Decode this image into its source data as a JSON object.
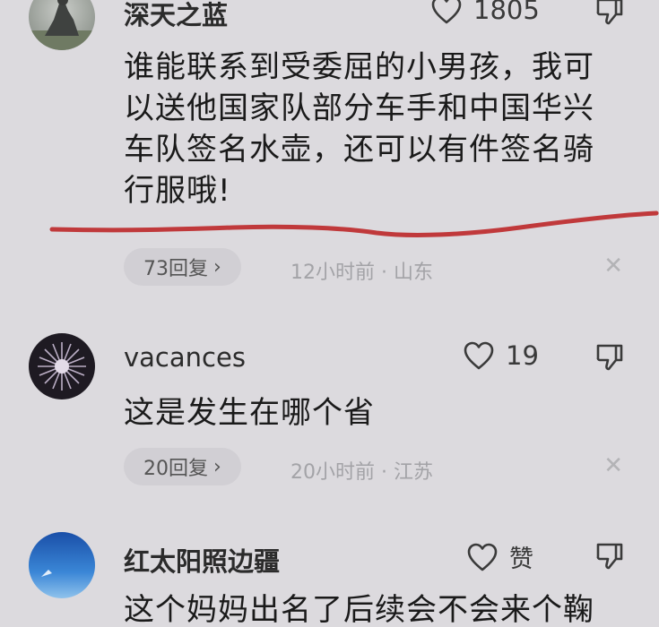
{
  "comments": [
    {
      "username": "深天之蓝",
      "likes": "1805",
      "body_lines": [
        "谁能联系到受委屈的小男孩，我可",
        "以送他国家队部分车手和中国华兴",
        "车队签名水壶，还可以有件签名骑",
        "行服哦!"
      ],
      "replies": "73回复",
      "meta": "12小时前 · 山东"
    },
    {
      "username": "vacances",
      "likes": "19",
      "body_lines": [
        "这是发生在哪个省"
      ],
      "replies": "20回复",
      "meta": "20小时前 · 江苏"
    },
    {
      "username": "红太阳照边疆",
      "likes": "赞",
      "body_lines": [
        "这个妈妈出名了后续会不会来个鞠"
      ]
    }
  ],
  "icons": {
    "like": "heart-outline-icon",
    "dislike": "thumbs-down-outline-icon",
    "chevron": "chevron-right-icon",
    "close": "close-icon"
  },
  "colors": {
    "background": "#dcdade",
    "annotation_line": "#c0393b",
    "meta_text": "#a3a3a7"
  }
}
